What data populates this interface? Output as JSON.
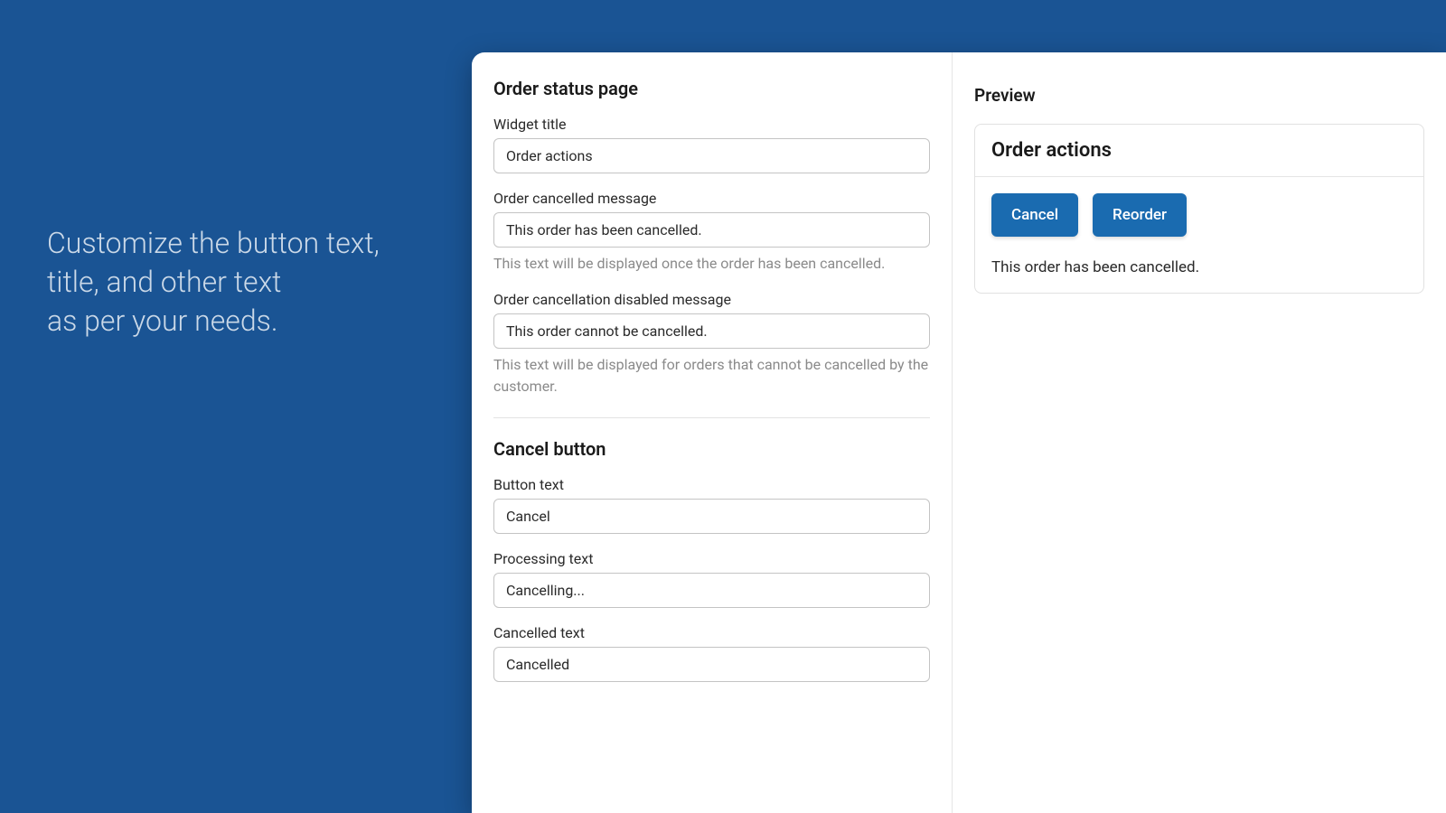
{
  "marketing": {
    "line1": "Customize the button text,",
    "line2": "title, and other text",
    "line3": "as per your needs."
  },
  "form": {
    "section_order_status_title": "Order status page",
    "widget_title": {
      "label": "Widget title",
      "value": "Order actions"
    },
    "cancelled_message": {
      "label": "Order cancelled message",
      "value": "This order has been cancelled.",
      "help": "This text will be displayed once the order has been cancelled."
    },
    "cancellation_disabled_message": {
      "label": "Order cancellation disabled message",
      "value": "This order cannot be cancelled.",
      "help": "This text will be displayed for orders that cannot be cancelled by the customer."
    },
    "section_cancel_button_title": "Cancel button",
    "button_text": {
      "label": "Button text",
      "value": "Cancel"
    },
    "processing_text": {
      "label": "Processing text",
      "value": "Cancelling..."
    },
    "cancelled_text": {
      "label": "Cancelled text",
      "value": "Cancelled"
    }
  },
  "preview": {
    "title": "Preview",
    "card_title": "Order actions",
    "cancel_button": "Cancel",
    "reorder_button": "Reorder",
    "message": "This order has been cancelled."
  }
}
